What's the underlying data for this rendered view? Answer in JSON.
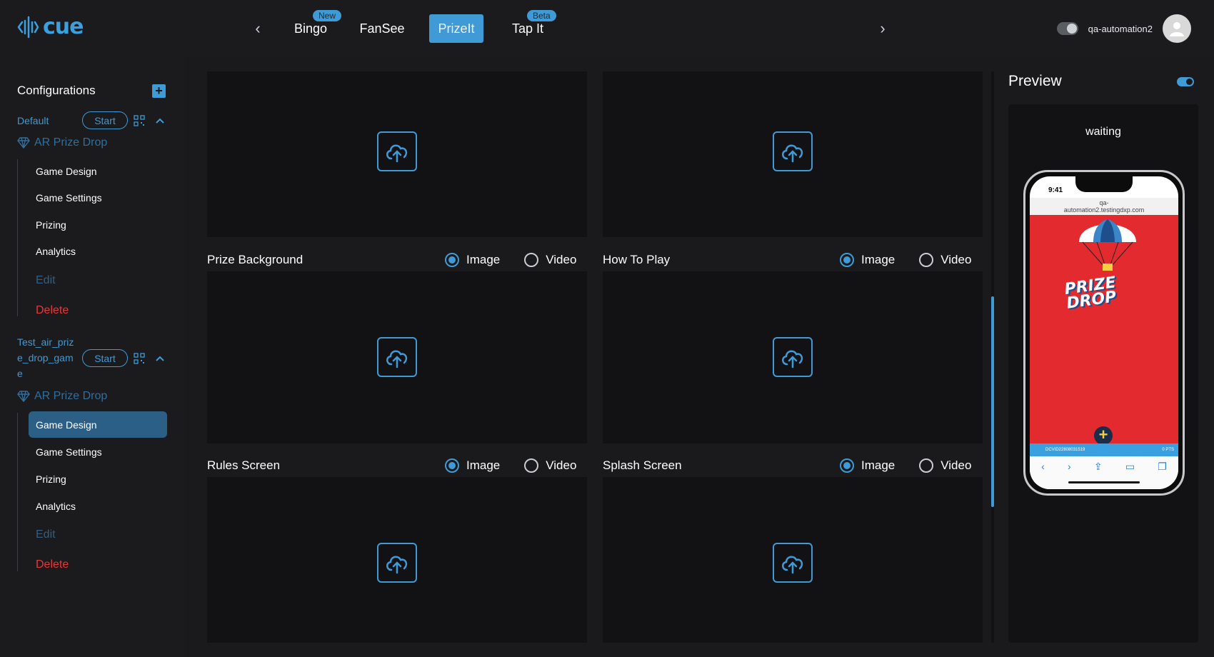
{
  "app": {
    "logo_text": "cue"
  },
  "nav": {
    "tabs": [
      {
        "label": "Bingo",
        "badge": "New"
      },
      {
        "label": "FanSee",
        "badge": ""
      },
      {
        "label": "PrizeIt",
        "badge": ""
      },
      {
        "label": "Tap It",
        "badge": "Beta"
      }
    ],
    "active_tab": "PrizeIt"
  },
  "user": {
    "name": "qa-automation2"
  },
  "sidebar": {
    "title": "Configurations",
    "configs": [
      {
        "name": "Default",
        "start_label": "Start",
        "game_type": "AR Prize Drop",
        "items": [
          "Game Design",
          "Game Settings",
          "Prizing",
          "Analytics",
          "Edit",
          "Delete"
        ]
      },
      {
        "name_lines": [
          "Test_air_priz",
          "e_drop_gam",
          "e"
        ],
        "start_label": "Start",
        "game_type": "AR Prize Drop",
        "items": [
          "Game Design",
          "Game Settings",
          "Prizing",
          "Analytics",
          "Edit",
          "Delete"
        ],
        "active_item": "Game Design"
      }
    ]
  },
  "main": {
    "rows": [
      {
        "left": {
          "label": "Prize Background",
          "selected": "Image"
        },
        "right": {
          "label": "How To Play",
          "selected": "Image"
        }
      },
      {
        "left": {
          "label": "Rules Screen",
          "selected": "Image"
        },
        "right": {
          "label": "Splash Screen",
          "selected": "Image"
        }
      }
    ],
    "radio_options": {
      "image": "Image",
      "video": "Video"
    }
  },
  "preview": {
    "title": "Preview",
    "status": "waiting",
    "phone": {
      "time": "9:41",
      "url_line1": "qa-",
      "url_line2": "automation2.testingdxp.com",
      "game_title_line1": "PRIZE",
      "game_title_line2": "DROP",
      "footer_code": "DCVID22808031519",
      "footer_points": "0 PTS"
    }
  },
  "colors": {
    "accent": "#3f9ad6",
    "danger": "#e5383b",
    "game_bg": "#e22a2f"
  }
}
